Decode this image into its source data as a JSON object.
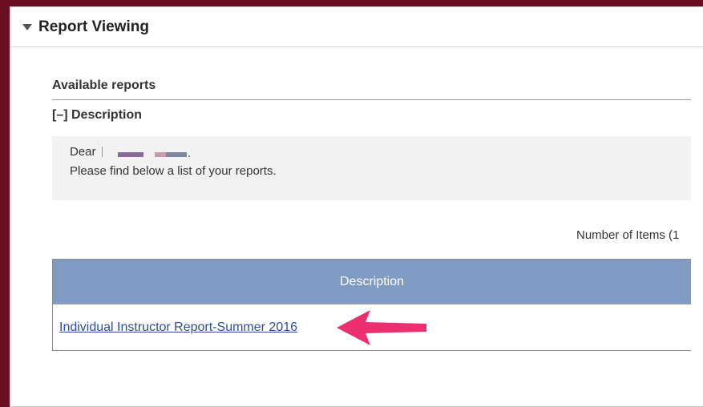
{
  "panel": {
    "title": "Report Viewing"
  },
  "section": {
    "title": "Available reports",
    "description_toggle": "[–] Description",
    "greeting": "Dear",
    "message": "Please find below a list of your reports."
  },
  "table": {
    "items_count": "Number of Items (1",
    "columns": [
      "Description"
    ],
    "rows": [
      {
        "description": "Individual Instructor Report-Summer 2016"
      }
    ]
  },
  "colors": {
    "background": "#6d0f22",
    "header_blue": "#7f9ac3",
    "link": "#2a4f9c",
    "arrow": "#ee2f6f"
  }
}
